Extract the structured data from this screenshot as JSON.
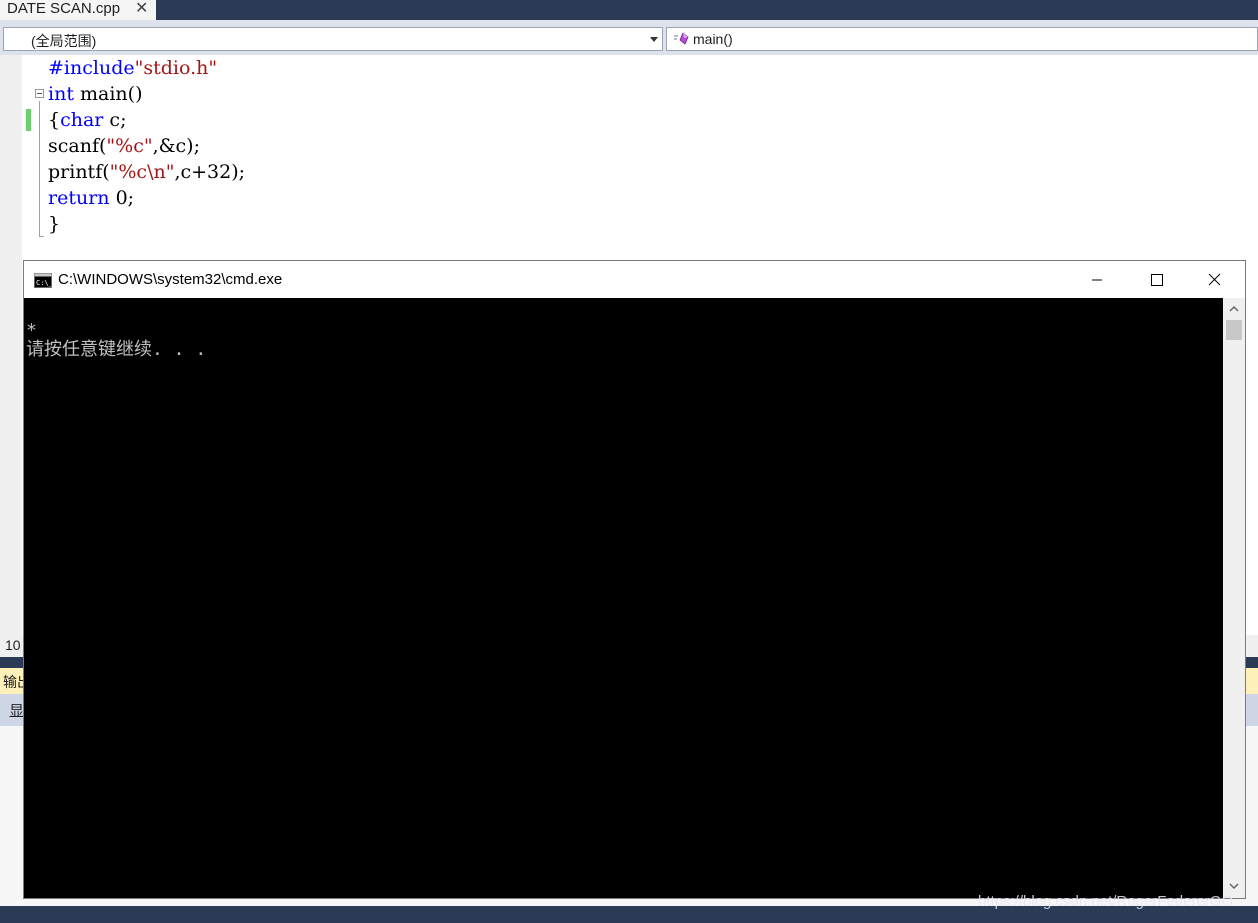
{
  "tab": {
    "label": "DATE SCAN.cpp",
    "close_glyph": "✕"
  },
  "navbar": {
    "scope": "(全局范围)",
    "member": "main()"
  },
  "code": {
    "line1": {
      "directive": "#include",
      "header": "\"stdio.h\""
    },
    "line2": {
      "kw": "int",
      "rest": " main()"
    },
    "line3": {
      "brace": "{",
      "kw": "char",
      "rest": " c;"
    },
    "line4": {
      "fn": "scanf(",
      "fmt": "\"%c\"",
      "rest": ",&c);"
    },
    "line5": {
      "fn": "printf(",
      "fmt": "\"%c\\n\"",
      "rest": ",c+32);"
    },
    "line6": {
      "kw": "return",
      "rest": " 0;"
    },
    "line7": {
      "text": "}"
    }
  },
  "ide_panels": {
    "zoom_partial": "10",
    "output_partial": "输出",
    "show_partial": "显"
  },
  "console": {
    "title": "C:\\WINDOWS\\system32\\cmd.exe",
    "lines": [
      "*",
      "请按任意键继续. . ."
    ]
  },
  "watermark": "https://blog.csdn.net/RogerFedererGO"
}
